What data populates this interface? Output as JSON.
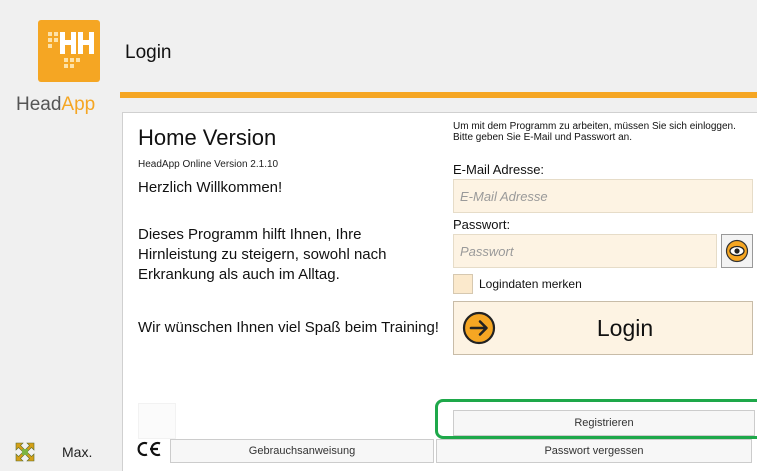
{
  "brand": {
    "name_part1": "Head",
    "name_part2": "App",
    "color": "#f5a623",
    "logo_text": "HH"
  },
  "sidebar": {
    "maximize_label": "Max.",
    "maximize_icon": "maximize-arrows-icon"
  },
  "header": {
    "title": "Login"
  },
  "intro": {
    "title": "Home Version",
    "version": "HeadApp Online Version 2.1.10",
    "welcome": "Herzlich Willkommen!",
    "description": "Dieses Programm hilft Ihnen, Ihre Hirnleistung zu steigern, sowohl nach Erkrankung als auch im Alltag.",
    "wish": "Wir wünschen Ihnen viel Spaß beim Training!"
  },
  "login": {
    "instructions": "Um mit dem Programm zu arbeiten, müssen Sie sich einloggen.",
    "instructions2": "Bitte geben Sie E-Mail und Passwort an.",
    "email_label": "E-Mail Adresse:",
    "email_placeholder": "E-Mail Adresse",
    "email_value": "",
    "password_label": "Passwort:",
    "password_placeholder": "Passwort",
    "password_value": "",
    "show_password_icon": "eye-icon",
    "remember_label": "Logindaten merken",
    "remember_checked": false,
    "login_button": "Login",
    "login_icon": "arrow-right-circle-icon",
    "register_button": "Registrieren"
  },
  "footer": {
    "ce_mark": "CE",
    "manual_button": "Gebrauchsanweisung",
    "forgot_button": "Passwort vergessen"
  },
  "highlight_color": "#1ea84a"
}
